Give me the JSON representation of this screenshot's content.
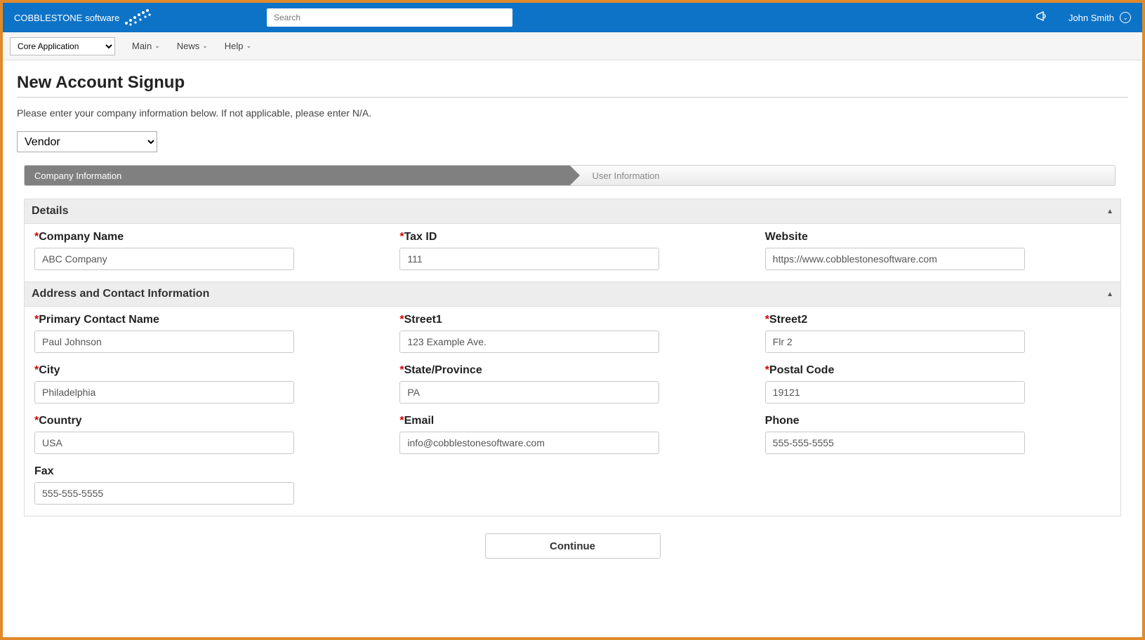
{
  "header": {
    "brand_main": "COBBLESTONE",
    "brand_sub": "software",
    "search_placeholder": "Search",
    "user_name": "John Smith"
  },
  "menubar": {
    "app_select": "Core Application",
    "items": [
      "Main",
      "News",
      "Help"
    ]
  },
  "page": {
    "title": "New Account Signup",
    "instruction": "Please enter your company information below. If not applicable, please enter N/A.",
    "type_select": "Vendor",
    "steps": {
      "active": "Company Information",
      "inactive": "User Information"
    },
    "sections": {
      "details": {
        "title": "Details",
        "fields": {
          "company_name": {
            "label": "Company Name",
            "value": "ABC Company",
            "required": true
          },
          "tax_id": {
            "label": "Tax ID",
            "value": "111",
            "required": true
          },
          "website": {
            "label": "Website",
            "value": "https://www.cobblestonesoftware.com",
            "required": false
          }
        }
      },
      "address": {
        "title": "Address and Contact Information",
        "fields": {
          "primary_contact": {
            "label": "Primary Contact Name",
            "value": "Paul Johnson",
            "required": true
          },
          "street1": {
            "label": "Street1",
            "value": "123 Example Ave.",
            "required": true
          },
          "street2": {
            "label": "Street2",
            "value": "Flr 2",
            "required": true
          },
          "city": {
            "label": "City",
            "value": "Philadelphia",
            "required": true
          },
          "state": {
            "label": "State/Province",
            "value": "PA",
            "required": true
          },
          "postal": {
            "label": "Postal Code",
            "value": "19121",
            "required": true
          },
          "country": {
            "label": "Country",
            "value": "USA",
            "required": true
          },
          "email": {
            "label": "Email",
            "value": "info@cobblestonesoftware.com",
            "required": true
          },
          "phone": {
            "label": "Phone",
            "value": "555-555-5555",
            "required": false
          },
          "fax": {
            "label": "Fax",
            "value": "555-555-5555",
            "required": false
          }
        }
      }
    },
    "continue_label": "Continue"
  }
}
